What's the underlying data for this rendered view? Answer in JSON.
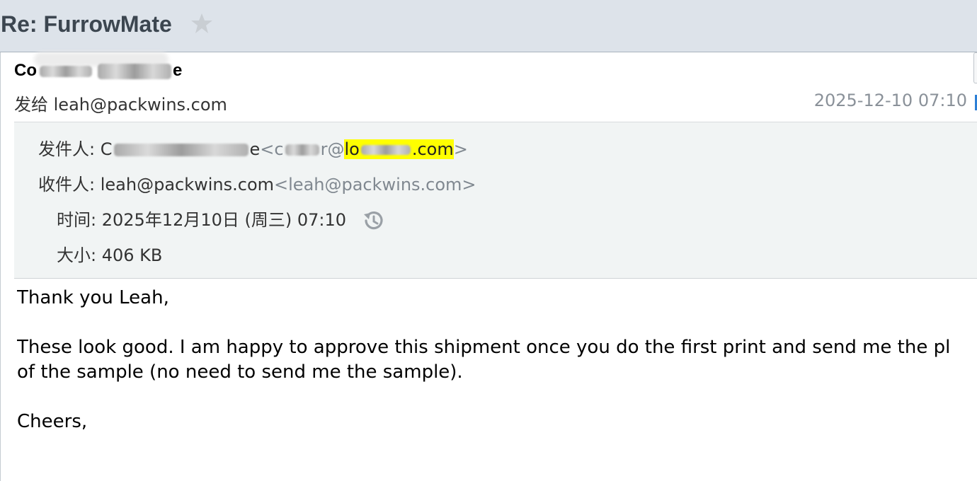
{
  "email": {
    "subject": "Re: FurrowMate",
    "star_icon": "star-icon",
    "sender": {
      "name_start": "Co",
      "name_end": "e"
    },
    "sendto_label": "发给",
    "sendto_email": "leah@packwins.com",
    "datetime_short": "2025-12-10 07:10",
    "details": {
      "from_label": "发件人:",
      "from_name_start": "C",
      "from_name_end": "e",
      "from_addr_open": "<c",
      "from_addr_mid": "r@",
      "from_domain_start": "lo",
      "from_domain_end": ".com",
      "from_addr_close": ">",
      "to_label": "收件人:",
      "to_name": "leah@packwins.com",
      "to_addr": "<leah@packwins.com>",
      "time_label": "时间:",
      "time_value": "2025年12月10日 (周三) 07:10",
      "size_label": "大小:",
      "size_value": "406 KB"
    },
    "body": {
      "line1": "Thank you Leah,",
      "line2": "These look good. I am happy to approve this shipment once you do the first print and send me the pl",
      "line3": "of the sample (no need to send me the sample).",
      "line4": "Cheers,"
    }
  },
  "colors": {
    "titlebar_bg": "#dde3ea",
    "details_bg": "#f1f4f4",
    "highlight": "#ffff00"
  }
}
